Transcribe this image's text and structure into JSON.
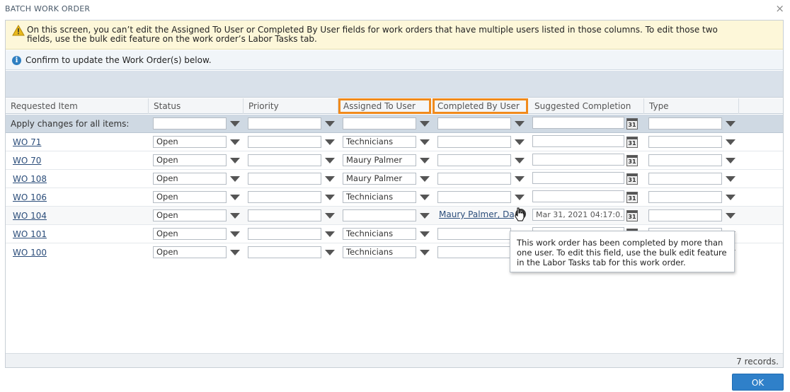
{
  "window": {
    "title": "BATCH WORK ORDER",
    "close_glyph": "×"
  },
  "warning": {
    "icon": "warning-icon",
    "text": "On this screen, you can’t edit the Assigned To User or Completed By User fields for work orders that have multiple users listed in those columns. To edit those two fields, use the bulk edit feature on the work order’s Labor Tasks tab."
  },
  "info": {
    "icon": "info-icon",
    "glyph": "i",
    "text": "Confirm to update the Work Order(s) below."
  },
  "columns": {
    "requested_item": "Requested Item",
    "status": "Status",
    "priority": "Priority",
    "assigned_to": "Assigned To User",
    "completed_by": "Completed By User",
    "suggested_date": "Suggested Completion Date",
    "type": "Type"
  },
  "apply_row": {
    "label": "Apply changes for all items:"
  },
  "calendar_glyph": "31",
  "rows": [
    {
      "item": "WO 71",
      "status": "Open",
      "priority": "",
      "assigned": "Technicians",
      "completed": "",
      "date": "",
      "type": ""
    },
    {
      "item": "WO 70",
      "status": "Open",
      "priority": "",
      "assigned": "Maury Palmer",
      "completed": "",
      "date": "",
      "type": ""
    },
    {
      "item": "WO 108",
      "status": "Open",
      "priority": "",
      "assigned": "Maury Palmer",
      "completed": "",
      "date": "",
      "type": ""
    },
    {
      "item": "WO 106",
      "status": "Open",
      "priority": "",
      "assigned": "Technicians",
      "completed": "",
      "date": "",
      "type": ""
    },
    {
      "item": "WO 104",
      "status": "Open",
      "priority": "",
      "assigned": "",
      "completed": "Maury Palmer, Da...",
      "date": "Mar 31, 2021 04:17:0...",
      "type": ""
    },
    {
      "item": "WO 101",
      "status": "Open",
      "priority": "",
      "assigned": "Technicians",
      "completed": "",
      "date": "",
      "type": ""
    },
    {
      "item": "WO 100",
      "status": "Open",
      "priority": "",
      "assigned": "Technicians",
      "completed": "",
      "date": "",
      "type": ""
    }
  ],
  "multi_user_icon_glyph": "?",
  "tooltip": {
    "text": "This work order has been completed by more than one user. To edit this field, use the bulk edit feature in the Labor Tasks tab for this work order."
  },
  "footer": {
    "records": "7 records."
  },
  "ok_button": {
    "label": "OK"
  },
  "colors": {
    "highlight": "#f08a1c",
    "ok_button": "#2f80c9",
    "warning_bg": "#fdf7d9",
    "link": "#2b4d7a"
  }
}
